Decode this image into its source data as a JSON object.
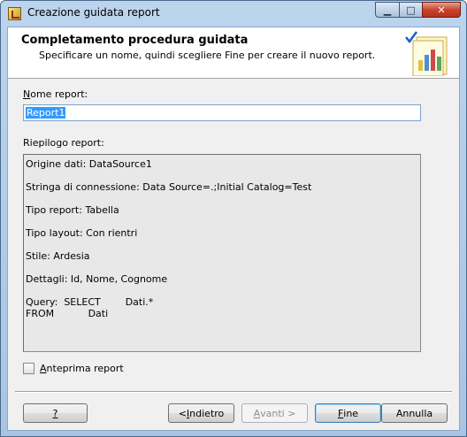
{
  "window": {
    "title": "Creazione guidata report",
    "icon": "report-wizard-icon"
  },
  "header": {
    "title": "Completamento procedura guidata",
    "subtitle": "Specificare un nome, quindi scegliere Fine per creare il nuovo report."
  },
  "form": {
    "name_label_accel": "N",
    "name_label_rest": "ome report:",
    "name_value": "Report1",
    "summary_label": "Riepilogo report:",
    "summary_lines": [
      "Origine dati: DataSource1",
      "Stringa di connessione: Data Source=.;Initial Catalog=Test",
      "Tipo report: Tabella",
      "Tipo layout: Con rientri",
      "Stile: Ardesia",
      "Dettagli: Id, Nome, Cognome",
      "Query:  SELECT        Dati.*\nFROM           Dati"
    ],
    "preview_label_accel": "A",
    "preview_label_rest": "nteprima report",
    "preview_checked": false
  },
  "buttons": {
    "help": "?",
    "back_prefix": "< ",
    "back_accel": "I",
    "back_rest": "ndietro",
    "next_accel": "A",
    "next_rest": "vanti >",
    "finish_accel": "F",
    "finish_rest": "ine",
    "cancel": "Annulla"
  }
}
